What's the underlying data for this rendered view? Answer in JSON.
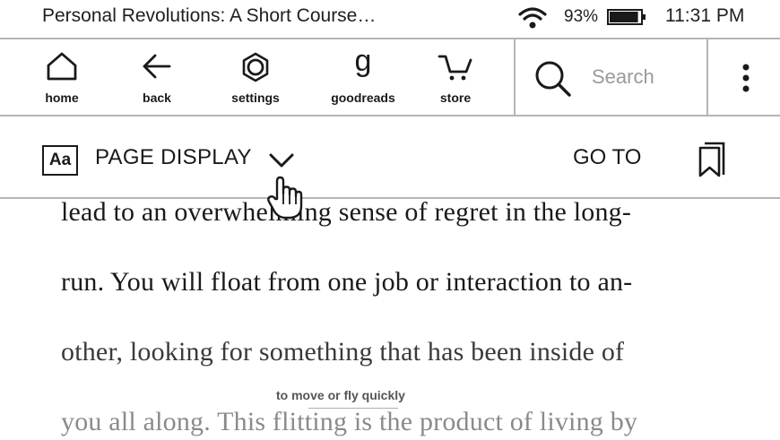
{
  "status": {
    "book_title": "Personal Revolutions: A Short Course…",
    "battery": "93%",
    "battery_level": 0.93,
    "time": "11:31 PM",
    "icons": [
      "wifi-icon",
      "battery-icon"
    ]
  },
  "toolbar": {
    "home": "home",
    "back": "back",
    "settings": "settings",
    "goodreads": "goodreads",
    "goodreads_glyph": "g",
    "store": "store",
    "search_placeholder": "Search",
    "icons": [
      "home-icon",
      "back-arrow-icon",
      "settings-gear-icon",
      "goodreads-icon",
      "cart-icon",
      "search-icon",
      "more-vertical-icon"
    ]
  },
  "page_display": {
    "aa": "Aa",
    "label": "PAGE DISPLAY",
    "goto": "GO TO",
    "icons": [
      "chevron-down-icon",
      "bookmark-icon",
      "hand-cursor-icon"
    ]
  },
  "content": {
    "lines": [
      "lead to an overwhelming sense of regret in the long-",
      "run. You will float from one job or interaction to an-",
      "other, looking for something that has been inside of",
      "you all along. This flitting is the product of living by"
    ],
    "tooltip": "to move or fly quickly"
  },
  "colors": {
    "text": "#1a1a1a",
    "border": "#b5b5b5",
    "muted": "#9a9a9a"
  }
}
